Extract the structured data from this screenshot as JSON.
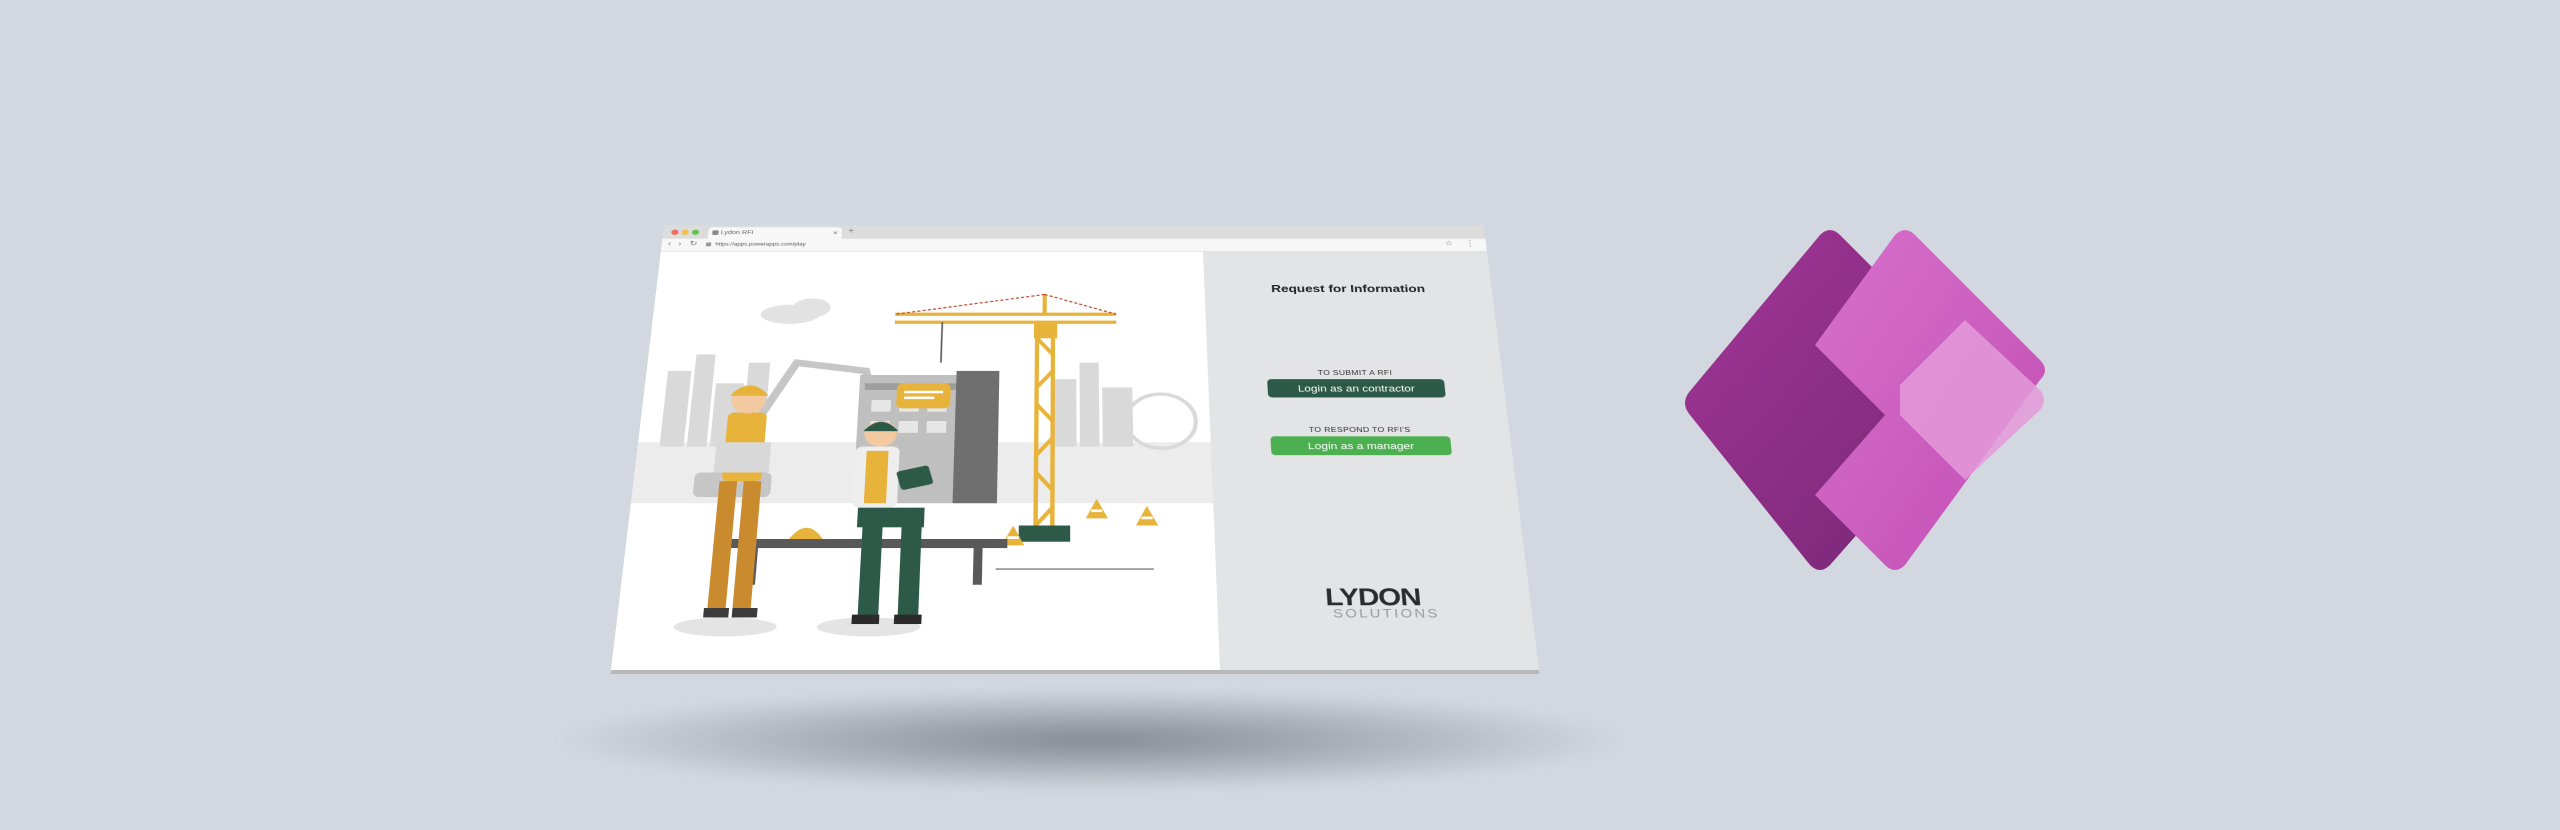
{
  "browser": {
    "tab_title": "Lydon RFI",
    "url": "https://apps.powerapps.com/play"
  },
  "page": {
    "title": "Request for Information",
    "contractor": {
      "caption": "TO SUBMIT A RFI",
      "button_label": "Login as an contractor",
      "button_color": "#2d5a48"
    },
    "manager": {
      "caption": "TO RESPOND TO RFI'S",
      "button_label": "Login as a manager",
      "button_color": "#4caf50"
    },
    "logo": {
      "brand": "LYDON",
      "subtitle": "SOLUTIONS"
    }
  },
  "decor": {
    "illustration": "construction-site-illustration",
    "product_logo": "power-apps-logo"
  },
  "colors": {
    "background": "#d3d8e0",
    "powerapps_dark": "#8b2a82",
    "powerapps_mid": "#c95bbd",
    "powerapps_light": "#e49ad8"
  }
}
